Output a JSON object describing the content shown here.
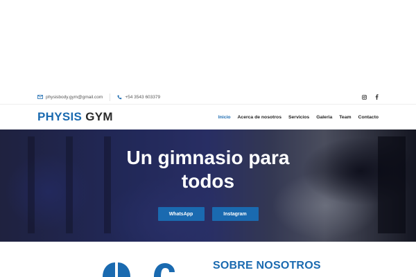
{
  "topbar": {
    "email": "physisbody.gym@gmail.com",
    "phone": "+54 3543 603379",
    "social": [
      "instagram-icon",
      "facebook-icon"
    ]
  },
  "header": {
    "logo_part1": "PHYSIS",
    "logo_part2": "GYM",
    "nav": [
      "Inicio",
      "Acerca de nosotros",
      "Servicios",
      "Galeria",
      "Team",
      "Contacto"
    ],
    "active": "Inicio"
  },
  "hero": {
    "title_line1": "Un gimnasio para",
    "title_line2": "todos",
    "buttons": [
      "WhatsApp",
      "Instagram"
    ]
  },
  "about": {
    "title": "SOBRE NOSOTROS"
  },
  "colors": {
    "accent": "#1a6ab0",
    "text": "#2a2a2a"
  }
}
